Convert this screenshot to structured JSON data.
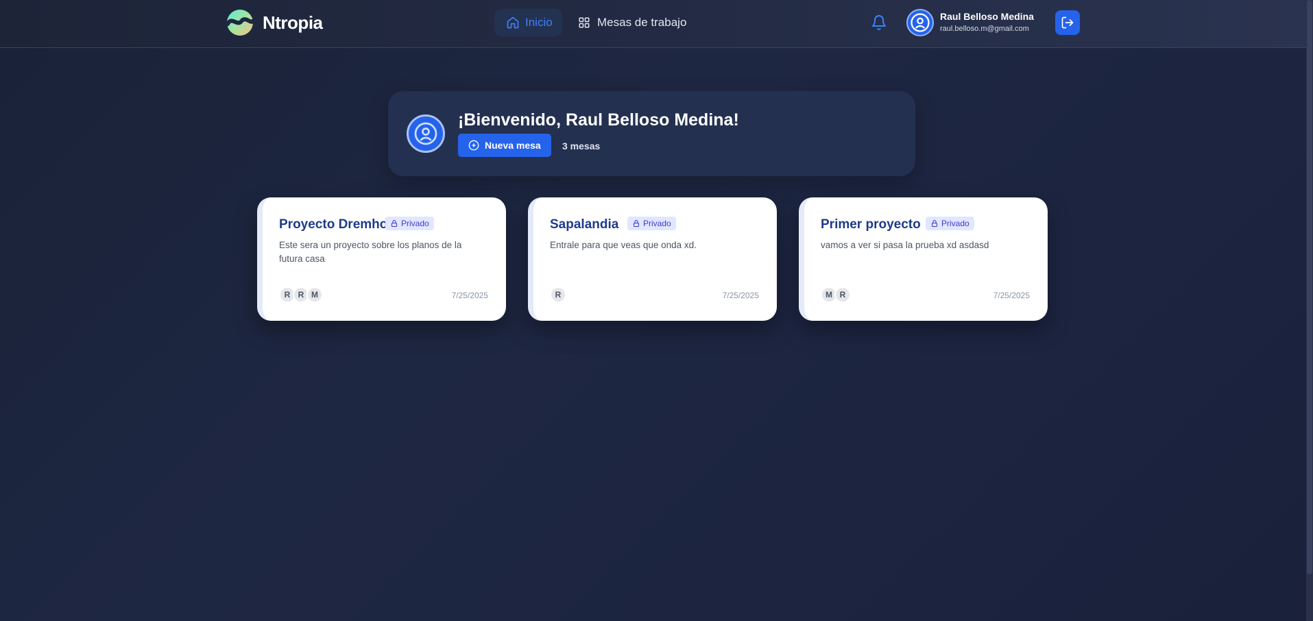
{
  "header": {
    "brand": "Ntropia",
    "nav": {
      "inicio": "Inicio",
      "mesas": "Mesas de trabajo"
    },
    "user": {
      "name": "Raul Belloso Medina",
      "email": "raul.belloso.m@gmail.com"
    }
  },
  "welcome": {
    "title": "¡Bienvenido, Raul Belloso Medina!",
    "new_button": "Nueva mesa",
    "count": "3 mesas"
  },
  "cards": [
    {
      "title": "Proyecto Dremhous",
      "badge": "Privado",
      "description": "Este sera un proyecto sobre los planos de la futura casa",
      "members": [
        "R",
        "R",
        "M"
      ],
      "date": "7/25/2025"
    },
    {
      "title": "Sapalandia",
      "badge": "Privado",
      "description": "Entrale para que veas que onda xd.",
      "members": [
        "R"
      ],
      "date": "7/25/2025"
    },
    {
      "title": "Primer proyecto",
      "badge": "Privado",
      "description": "vamos a ver si pasa la prueba xd asdasd",
      "members": [
        "M",
        "R"
      ],
      "date": "7/25/2025"
    }
  ],
  "colors": {
    "accent": "#2563eb",
    "background": "#1e2742",
    "card_title": "#1e3a8a",
    "badge_bg": "#e0e7ff"
  },
  "icons": {
    "logo": "ntropia-logo",
    "inicio": "home-icon",
    "mesas": "grid-icon",
    "notifications": "bell-icon",
    "user": "user-circle-icon",
    "logout": "logout-icon",
    "new": "plus-circle-icon",
    "badge": "lock-icon"
  }
}
